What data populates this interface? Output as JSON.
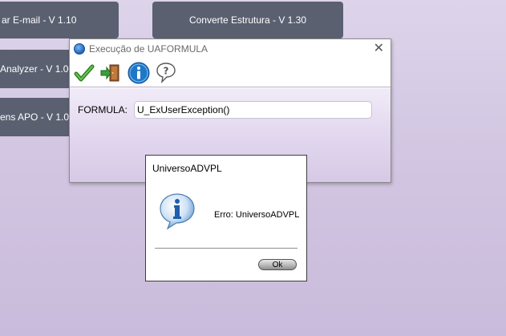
{
  "background_tiles": [
    {
      "label": "ar E-mail - V 1.10"
    },
    {
      "label": "Converte Estrutura - V 1.30"
    },
    {
      "label": "Analyzer - V 1.00"
    },
    {
      "label": "ens APO - V 1.00"
    }
  ],
  "window": {
    "title": "Execução de UAFORMULA",
    "close_icon": "close-icon",
    "toolbar": [
      {
        "icon": "checkmark-icon"
      },
      {
        "icon": "exit-door-icon"
      },
      {
        "icon": "info-icon"
      },
      {
        "icon": "help-icon"
      }
    ],
    "formula_label": "FORMULA:",
    "formula_value": "U_ExUserException()"
  },
  "dialog": {
    "title": "UniversoADVPL",
    "icon": "info-bubble-icon",
    "message": "Erro: UniversoADVPL",
    "ok_label": "Ok"
  },
  "colors": {
    "tile_bg": "#5b6071",
    "desktop_bg": "#d2c6e2",
    "check_green": "#3a9a2a",
    "info_blue": "#1e78c8"
  }
}
